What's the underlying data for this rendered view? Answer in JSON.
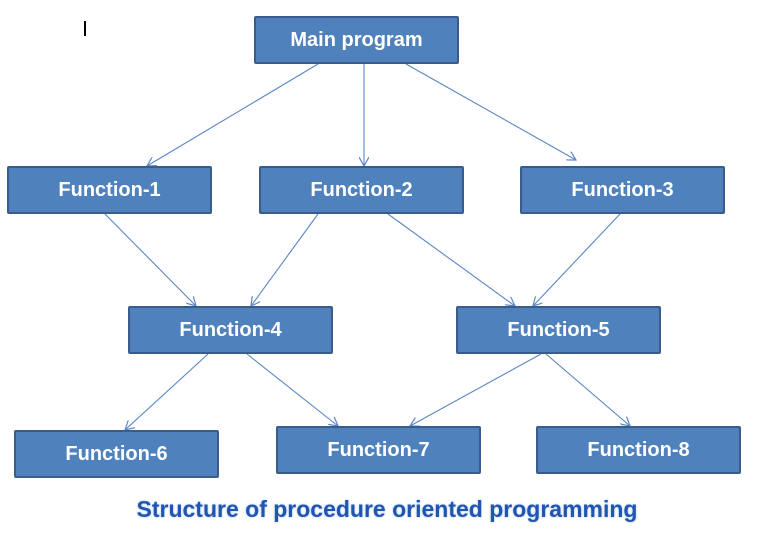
{
  "diagram": {
    "caption": "Structure of procedure oriented programming",
    "colors": {
      "box_fill": "#4f81bd",
      "box_border": "#385d8a",
      "edge": "#5b87c5",
      "caption": "#2255b0"
    },
    "nodes": {
      "main": "Main  program",
      "f1": "Function-1",
      "f2": "Function-2",
      "f3": "Function-3",
      "f4": "Function-4",
      "f5": "Function-5",
      "f6": "Function-6",
      "f7": "Function-7",
      "f8": "Function-8"
    },
    "edges": [
      [
        "main",
        "f1"
      ],
      [
        "main",
        "f2"
      ],
      [
        "main",
        "f3"
      ],
      [
        "f1",
        "f4"
      ],
      [
        "f2",
        "f4"
      ],
      [
        "f2",
        "f5"
      ],
      [
        "f3",
        "f5"
      ],
      [
        "f4",
        "f6"
      ],
      [
        "f4",
        "f7"
      ],
      [
        "f5",
        "f7"
      ],
      [
        "f5",
        "f8"
      ]
    ]
  }
}
